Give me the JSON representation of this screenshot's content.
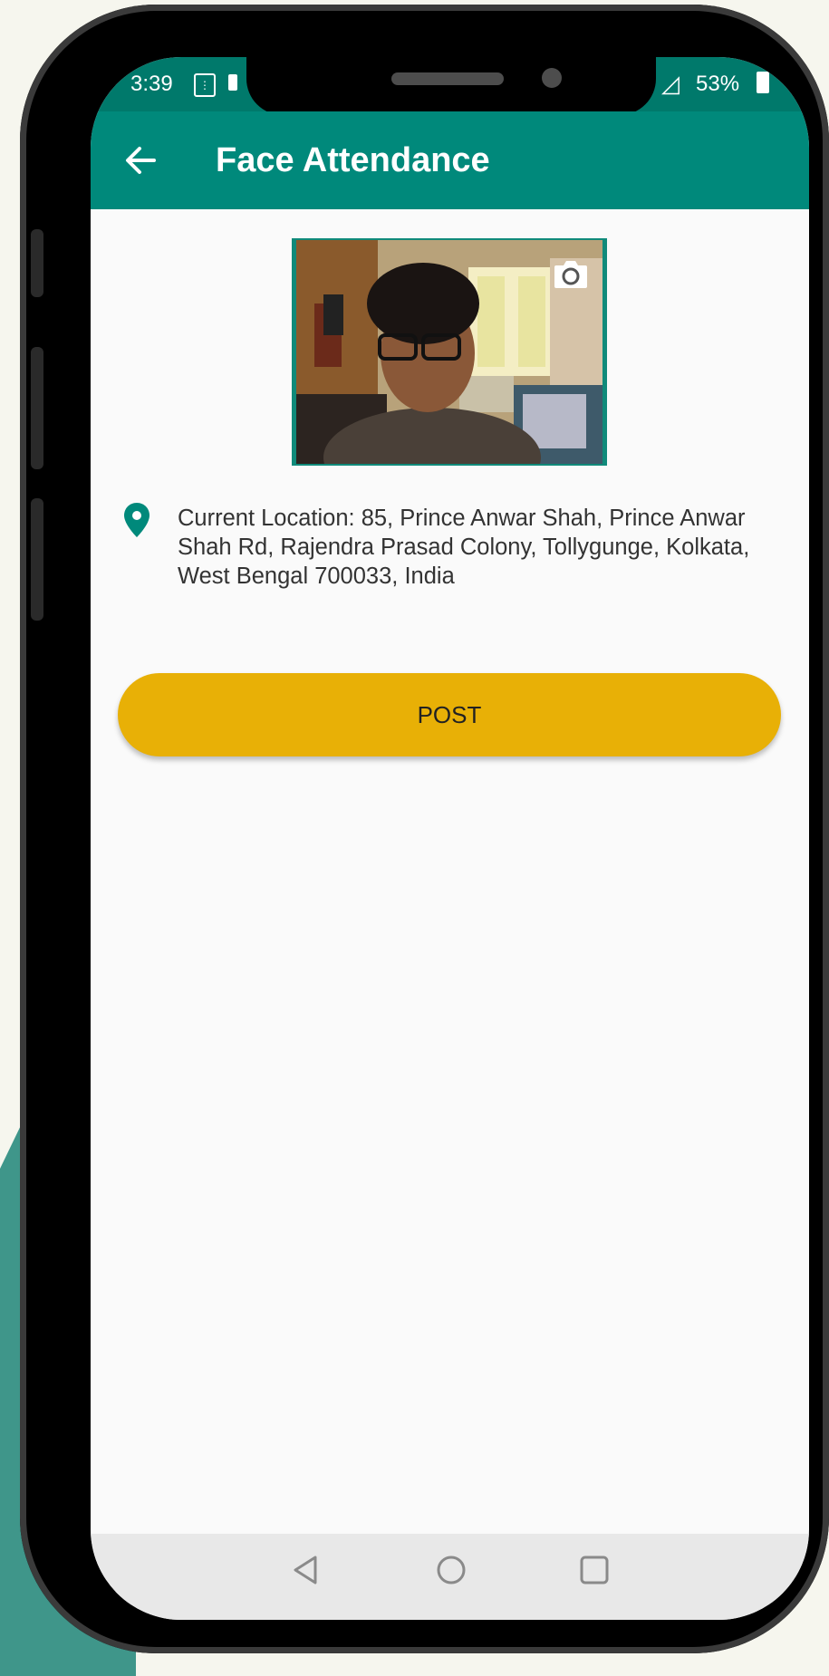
{
  "status_bar": {
    "time": "3:39",
    "battery": "53%"
  },
  "app_bar": {
    "title": "Face Attendance",
    "back_icon": "arrow-left-icon",
    "color": "#00897b"
  },
  "photo": {
    "camera_icon": "camera-icon"
  },
  "location": {
    "icon": "location-pin-icon",
    "text": "Current Location: 85, Prince Anwar Shah, Prince Anwar Shah Rd, Rajendra Prasad Colony, Tollygunge, Kolkata, West Bengal 700033, India"
  },
  "post_button": {
    "label": "POST",
    "color": "#e8b006"
  },
  "nav_bar": {
    "icons": [
      "back-triangle-icon",
      "home-circle-icon",
      "recents-square-icon"
    ]
  }
}
